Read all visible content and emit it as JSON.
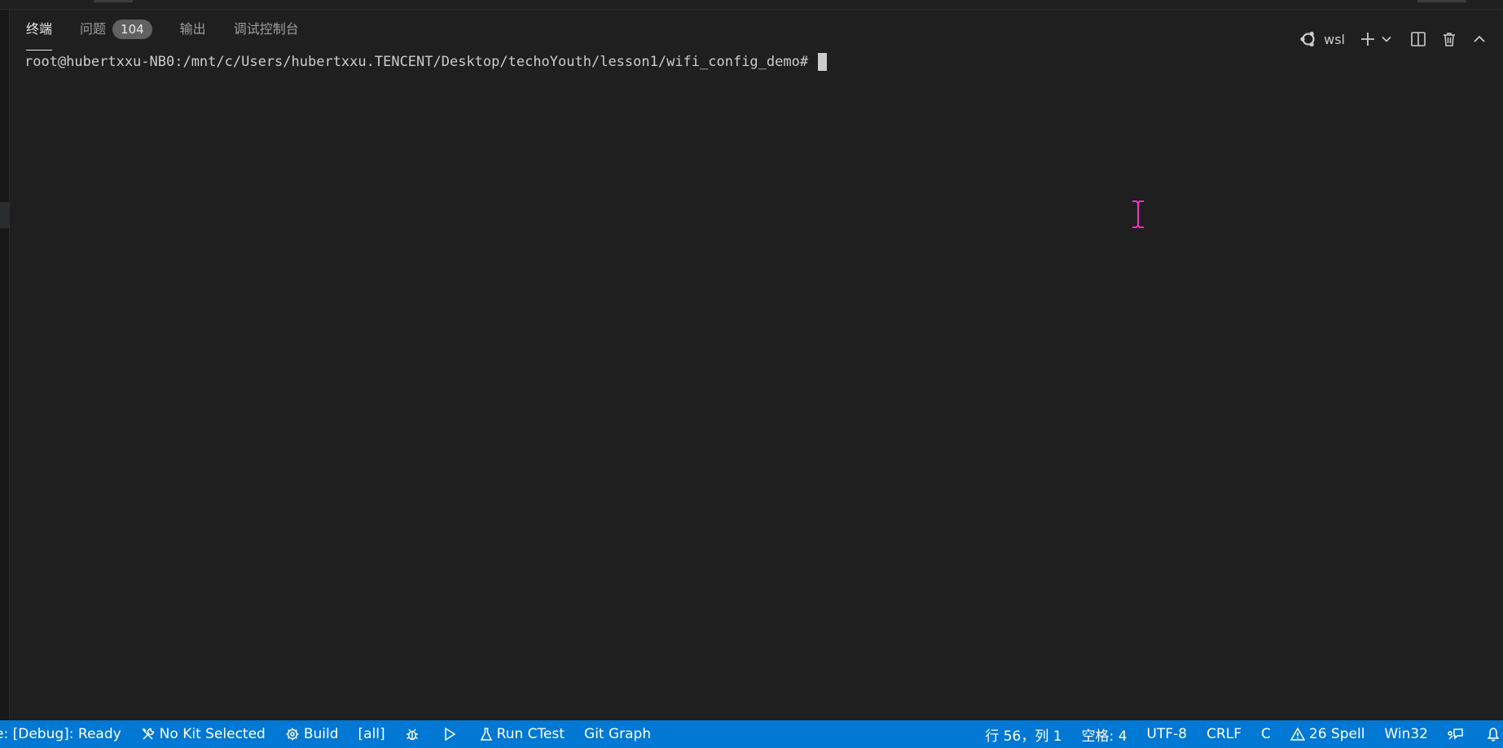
{
  "panel": {
    "tabs": [
      {
        "label": "终端",
        "active": true
      },
      {
        "label": "问题",
        "badge": "104"
      },
      {
        "label": "输出"
      },
      {
        "label": "调试控制台"
      }
    ],
    "actions": {
      "profile_label": "wsl"
    },
    "icons": [
      "ubuntu-icon",
      "plus-icon",
      "chevron-down-icon",
      "split-icon",
      "trash-icon",
      "chevron-up-icon"
    ]
  },
  "terminal": {
    "prompt": "root@hubertxxu-NB0:/mnt/c/Users/hubertxxu.TENCENT/Desktop/techoYouth/lesson1/wifi_config_demo#"
  },
  "statusbar": {
    "left": {
      "status": "e: [Debug]: Ready",
      "kit": "No Kit Selected",
      "build": "Build",
      "target": "[all]",
      "ctest": "Run CTest",
      "git_graph": "Git Graph"
    },
    "right": {
      "position": "行 56，列 1",
      "spaces": "空格: 4",
      "encoding": "UTF-8",
      "eol": "CRLF",
      "language": "C",
      "spell": "26 Spell",
      "platform": "Win32"
    }
  },
  "colors": {
    "background": "#1f1f1f",
    "statusbar": "#0078d4",
    "badge": "#616161",
    "text": "#cccccc",
    "cursor_ibeam": "#ff2bd6"
  }
}
